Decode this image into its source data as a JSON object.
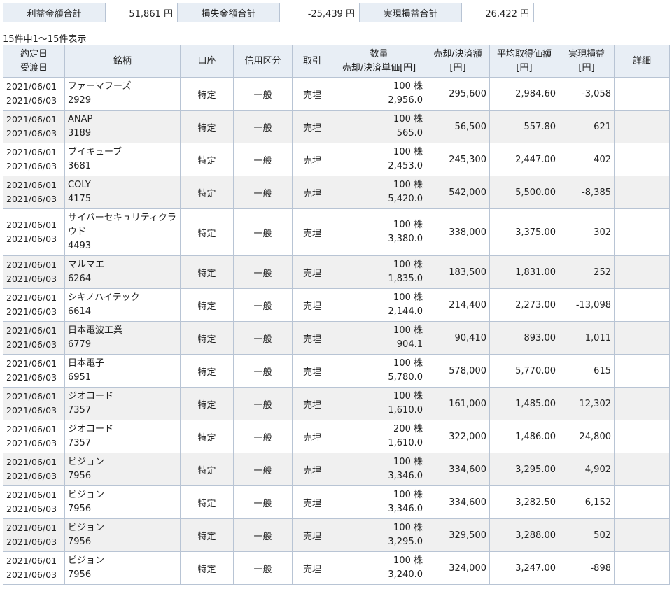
{
  "summary": {
    "profit_label": "利益金額合計",
    "profit_value": "51,861 円",
    "loss_label": "損失金額合計",
    "loss_value": "-25,439 円",
    "realized_label": "実現損益合計",
    "realized_value": "26,422 円"
  },
  "count_text": "15件中1～15件表示",
  "headers": {
    "date1": "約定日",
    "date2": "受渡日",
    "name": "銘柄",
    "account": "口座",
    "margin": "信用区分",
    "trade": "取引",
    "qty1": "数量",
    "qty2": "売却/決済単価[円]",
    "amount1": "売却/決済額",
    "amount2": "[円]",
    "avg1": "平均取得価額",
    "avg2": "[円]",
    "pl1": "実現損益",
    "pl2": "[円]",
    "detail": "詳細"
  },
  "rows": [
    {
      "trade_date": "2021/06/01",
      "settle_date": "2021/06/03",
      "name": "ファーマフーズ",
      "code": "2929",
      "account": "特定",
      "margin": "一般",
      "trade": "売埋",
      "qty": "100 株",
      "price": "2,956.0",
      "amount": "295,600",
      "avg": "2,984.60",
      "pl": "-3,058"
    },
    {
      "trade_date": "2021/06/01",
      "settle_date": "2021/06/03",
      "name": "ANAP",
      "code": "3189",
      "account": "特定",
      "margin": "一般",
      "trade": "売埋",
      "qty": "100 株",
      "price": "565.0",
      "amount": "56,500",
      "avg": "557.80",
      "pl": "621"
    },
    {
      "trade_date": "2021/06/01",
      "settle_date": "2021/06/03",
      "name": "ブイキューブ",
      "code": "3681",
      "account": "特定",
      "margin": "一般",
      "trade": "売埋",
      "qty": "100 株",
      "price": "2,453.0",
      "amount": "245,300",
      "avg": "2,447.00",
      "pl": "402"
    },
    {
      "trade_date": "2021/06/01",
      "settle_date": "2021/06/03",
      "name": "COLY",
      "code": "4175",
      "account": "特定",
      "margin": "一般",
      "trade": "売埋",
      "qty": "100 株",
      "price": "5,420.0",
      "amount": "542,000",
      "avg": "5,500.00",
      "pl": "-8,385"
    },
    {
      "trade_date": "2021/06/01",
      "settle_date": "2021/06/03",
      "name": "サイバーセキュリティクラウド",
      "code": "4493",
      "account": "特定",
      "margin": "一般",
      "trade": "売埋",
      "qty": "100 株",
      "price": "3,380.0",
      "amount": "338,000",
      "avg": "3,375.00",
      "pl": "302"
    },
    {
      "trade_date": "2021/06/01",
      "settle_date": "2021/06/03",
      "name": "マルマエ",
      "code": "6264",
      "account": "特定",
      "margin": "一般",
      "trade": "売埋",
      "qty": "100 株",
      "price": "1,835.0",
      "amount": "183,500",
      "avg": "1,831.00",
      "pl": "252"
    },
    {
      "trade_date": "2021/06/01",
      "settle_date": "2021/06/03",
      "name": "シキノハイテック",
      "code": "6614",
      "account": "特定",
      "margin": "一般",
      "trade": "売埋",
      "qty": "100 株",
      "price": "2,144.0",
      "amount": "214,400",
      "avg": "2,273.00",
      "pl": "-13,098"
    },
    {
      "trade_date": "2021/06/01",
      "settle_date": "2021/06/03",
      "name": "日本電波工業",
      "code": "6779",
      "account": "特定",
      "margin": "一般",
      "trade": "売埋",
      "qty": "100 株",
      "price": "904.1",
      "amount": "90,410",
      "avg": "893.00",
      "pl": "1,011"
    },
    {
      "trade_date": "2021/06/01",
      "settle_date": "2021/06/03",
      "name": "日本電子",
      "code": "6951",
      "account": "特定",
      "margin": "一般",
      "trade": "売埋",
      "qty": "100 株",
      "price": "5,780.0",
      "amount": "578,000",
      "avg": "5,770.00",
      "pl": "615"
    },
    {
      "trade_date": "2021/06/01",
      "settle_date": "2021/06/03",
      "name": "ジオコード",
      "code": "7357",
      "account": "特定",
      "margin": "一般",
      "trade": "売埋",
      "qty": "100 株",
      "price": "1,610.0",
      "amount": "161,000",
      "avg": "1,485.00",
      "pl": "12,302"
    },
    {
      "trade_date": "2021/06/01",
      "settle_date": "2021/06/03",
      "name": "ジオコード",
      "code": "7357",
      "account": "特定",
      "margin": "一般",
      "trade": "売埋",
      "qty": "200 株",
      "price": "1,610.0",
      "amount": "322,000",
      "avg": "1,486.00",
      "pl": "24,800"
    },
    {
      "trade_date": "2021/06/01",
      "settle_date": "2021/06/03",
      "name": "ビジョン",
      "code": "7956",
      "account": "特定",
      "margin": "一般",
      "trade": "売埋",
      "qty": "100 株",
      "price": "3,346.0",
      "amount": "334,600",
      "avg": "3,295.00",
      "pl": "4,902"
    },
    {
      "trade_date": "2021/06/01",
      "settle_date": "2021/06/03",
      "name": "ビジョン",
      "code": "7956",
      "account": "特定",
      "margin": "一般",
      "trade": "売埋",
      "qty": "100 株",
      "price": "3,346.0",
      "amount": "334,600",
      "avg": "3,282.50",
      "pl": "6,152"
    },
    {
      "trade_date": "2021/06/01",
      "settle_date": "2021/06/03",
      "name": "ビジョン",
      "code": "7956",
      "account": "特定",
      "margin": "一般",
      "trade": "売埋",
      "qty": "100 株",
      "price": "3,295.0",
      "amount": "329,500",
      "avg": "3,288.00",
      "pl": "502"
    },
    {
      "trade_date": "2021/06/01",
      "settle_date": "2021/06/03",
      "name": "ビジョン",
      "code": "7956",
      "account": "特定",
      "margin": "一般",
      "trade": "売埋",
      "qty": "100 株",
      "price": "3,240.0",
      "amount": "324,000",
      "avg": "3,247.00",
      "pl": "-898"
    }
  ]
}
